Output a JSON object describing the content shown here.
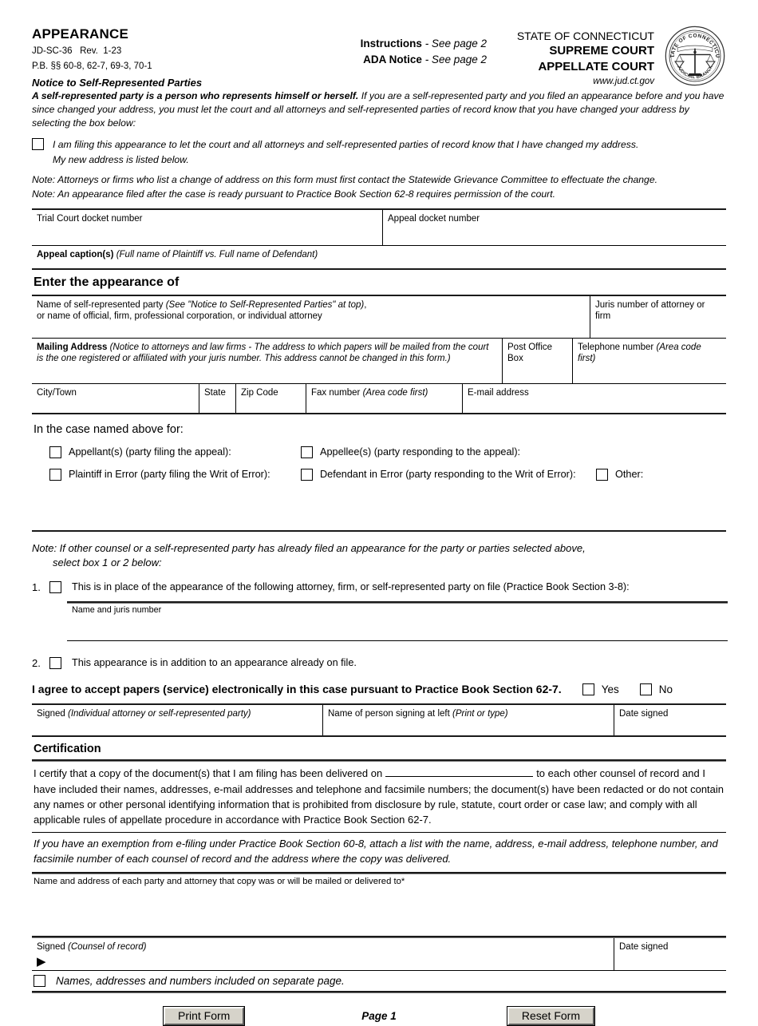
{
  "header": {
    "form_title": "APPEARANCE",
    "form_code": "JD-SC-36   Rev.  1-23",
    "practice_book": "P.B. §§ 60-8, 62-7, 69-3, 70-1",
    "instructions_label": "Instructions",
    "instructions_value": "- See page 2",
    "ada_label": "ADA Notice",
    "ada_value": "- See page 2",
    "state_line": "STATE OF CONNECTICUT",
    "court_line_1": "SUPREME COURT",
    "court_line_2": "APPELLATE COURT",
    "website": "www.jud.ct.gov",
    "seal_top_text": "STATE OF CONNECTICUT",
    "seal_bottom_text": "JUDICIAL BRANCH"
  },
  "notice": {
    "title": "Notice to Self-Represented Parties",
    "bold_lead": "A self-represented party is a person who represents himself or herself.",
    "body": " If you are a self-represented party and you filed an appearance before and you have since changed your address, you must let the court and all attorneys and self-represented parties of record know that you have changed your address by selecting the box below:",
    "checkbox_text": "I am filing this appearance to let the court and all attorneys and self-represented parties of record know that I have changed my address.",
    "sub_text": "My new address is listed below.",
    "note_1": "Note: Attorneys or firms who list a change of address on this form must first contact the Statewide Grievance Committee to effectuate the change.",
    "note_2": "Note: An appearance filed after the case is ready pursuant to Practice Book Section 62-8 requires permission of the court."
  },
  "docket": {
    "trial_court_label": "Trial Court docket number",
    "appeal_docket_label": "Appeal docket number",
    "caption_label_bold": "Appeal caption(s) ",
    "caption_label_italic": "(Full name of Plaintiff vs. Full name of Defendant)"
  },
  "appearance": {
    "section_title": "Enter the appearance of",
    "name_line_1_a": "Name of self-represented party ",
    "name_line_1_b": "(See \"Notice to Self-Represented Parties\" at top)",
    "name_line_1_c": ",",
    "name_line_2": "or name of official, firm, professional corporation, or individual attorney",
    "juris_label": "Juris number of attorney or firm",
    "mailing_bold": "Mailing Address ",
    "mailing_italic": "(Notice to attorneys and law firms - The address to which papers will be mailed from the court is the one registered or affiliated with your juris number. This address cannot be changed in this form.)",
    "po_box_label": "Post Office Box",
    "phone_label_a": "Telephone number ",
    "phone_label_b": "(Area code first)",
    "city_label": "City/Town",
    "state_label": "State",
    "zip_label": "Zip Code",
    "fax_label_a": "Fax number ",
    "fax_label_b": "(Area code first)",
    "email_label": "E-mail address"
  },
  "case_for": {
    "title": "In the case named above for:",
    "options": [
      {
        "label": "Appellant(s) (party filing the appeal):"
      },
      {
        "label": "Appellee(s) (party responding to the appeal):"
      },
      {
        "label": "Plaintiff in Error (party filing the Writ of Error):"
      },
      {
        "label": "Defendant in Error (party responding to the Writ of Error):"
      },
      {
        "label": "Other:"
      }
    ]
  },
  "selection": {
    "note_line_1": "Note: If other counsel or a self-represented party has already filed an appearance for the party or parties selected above,",
    "note_line_2": "select box 1 or 2 below:",
    "item_1_num": "1.",
    "item_1_text": "This is in place of the appearance of the following attorney, firm, or self-represented party on file (Practice Book Section 3-8):",
    "item_1_field_label": "Name and juris number",
    "item_2_num": "2.",
    "item_2_text": "This appearance is in addition to an appearance already on file."
  },
  "agreement": {
    "statement": "I agree to accept papers (service) electronically in this case pursuant to Practice Book Section 62-7.",
    "yes_label": "Yes",
    "no_label": "No"
  },
  "signature_1": {
    "signed_bold": "Signed ",
    "signed_italic": "(Individual attorney or self-represented party)",
    "name_bold": "Name of person signing at left ",
    "name_italic": "(Print or type)",
    "date_label": "Date signed"
  },
  "certification": {
    "section_title": "Certification",
    "body_part_1": "I certify that a copy of the document(s) that I am filing has been delivered on",
    "body_part_2": "to each other counsel of record and I have included their names, addresses, e-mail addresses and telephone and facsimile numbers; the document(s) have been redacted or do not contain any names or other personal identifying information that is prohibited from disclosure by rule, statute, court order or case law; and comply with all applicable rules of appellate procedure in accordance with Practice Book Section 62-7.",
    "exemption_note": "If you have an exemption from e-filing under Practice Book Section 60-8, attach a list with the name, address, e-mail address, telephone number, and facsimile number of each counsel of record and the address where the copy was delivered.",
    "names_label": "Name and address of each party and attorney that copy was or will be mailed or delivered to*"
  },
  "signature_2": {
    "signed_bold": "Signed ",
    "signed_italic": "(Counsel of record)",
    "arrow_glyph": "▶",
    "date_label": "Date signed",
    "separate_page_text": "Names, addresses and numbers included on separate page."
  },
  "footer": {
    "print_label": "Print Form",
    "page_label": "Page 1",
    "reset_label": "Reset Form"
  }
}
